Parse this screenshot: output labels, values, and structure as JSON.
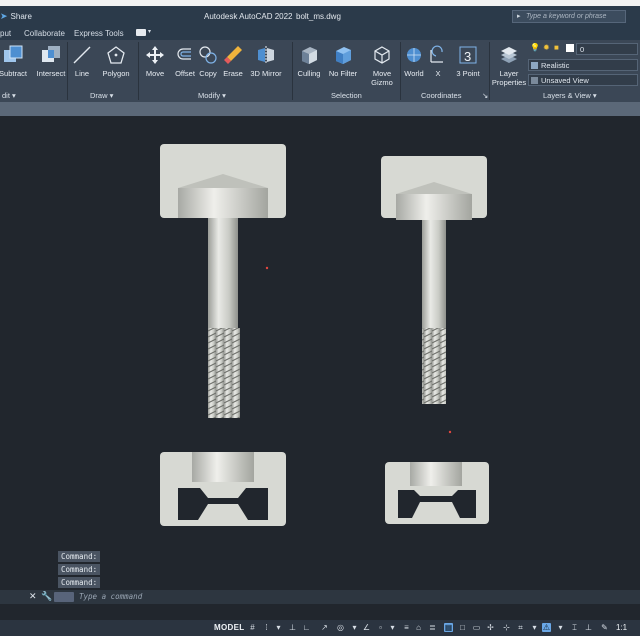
{
  "titlebar": {
    "share_label": "Share",
    "app_title": "Autodesk AutoCAD 2022",
    "file_name": "bolt_ms.dwg",
    "search_placeholder": "Type a keyword or phrase"
  },
  "tabs": [
    "put",
    "Collaborate",
    "Express Tools"
  ],
  "ribbon": {
    "solid": {
      "subtract": "Subtract",
      "intersect": "Intersect",
      "panel": "dit"
    },
    "draw": {
      "line": "Line",
      "polygon": "Polygon",
      "panel": "Draw"
    },
    "modify": {
      "move": "Move",
      "offset": "Offset",
      "copy": "Copy",
      "erase": "Erase",
      "mirror": "3D Mirror",
      "panel": "Modify"
    },
    "selection": {
      "culling": "Culling",
      "no_filter": "No Filter",
      "move_gizmo": "Move Gizmo",
      "panel": "Selection"
    },
    "coordinates": {
      "world": "World",
      "x": "X",
      "three_point": "3 Point",
      "panel": "Coordinates"
    },
    "layers": {
      "layer_properties": "Layer Properties",
      "layer_value": "0",
      "visual_style": "Realistic",
      "view": "Unsaved View",
      "panel": "Layers & View"
    }
  },
  "command": {
    "history": [
      "Command:",
      "Command:",
      "Command:"
    ],
    "placeholder": "Type a command"
  },
  "statusbar": {
    "model_label": "MODEL",
    "scale": "1:1"
  },
  "colors": {
    "viewport_bg": "#21262d",
    "ribbon_bg": "#3b4756",
    "part_fill": "#d7d9d3",
    "accent_blue": "#5fa8e6"
  }
}
